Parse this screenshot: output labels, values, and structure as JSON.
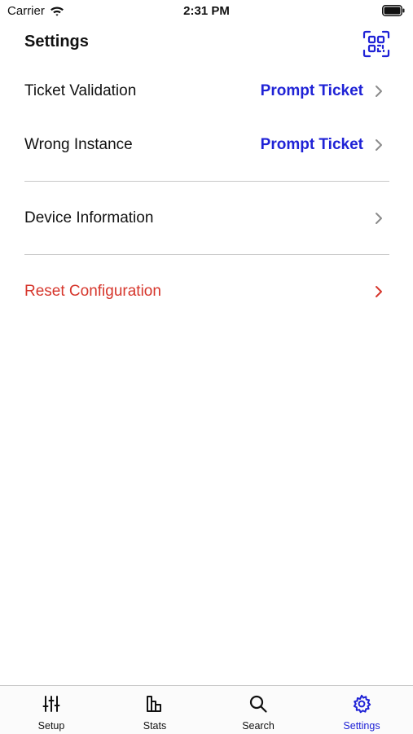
{
  "status_bar": {
    "carrier": "Carrier",
    "time": "2:31 PM"
  },
  "header": {
    "title": "Settings",
    "qr_icon": "qr-code-scan-icon"
  },
  "settings": [
    {
      "label": "Ticket Validation",
      "value": "Prompt Ticket"
    },
    {
      "label": "Wrong Instance",
      "value": "Prompt Ticket"
    },
    {
      "label": "Device Information",
      "value": ""
    },
    {
      "label": "Reset Configuration",
      "value": ""
    }
  ],
  "colors": {
    "accent": "#1f22d6",
    "danger": "#d6362c",
    "divider": "#c8c8c8"
  },
  "tabs": [
    {
      "label": "Setup",
      "icon": "sliders-icon",
      "active": false
    },
    {
      "label": "Stats",
      "icon": "bar-chart-icon",
      "active": false
    },
    {
      "label": "Search",
      "icon": "search-icon",
      "active": false
    },
    {
      "label": "Settings",
      "icon": "gear-icon",
      "active": true
    }
  ]
}
